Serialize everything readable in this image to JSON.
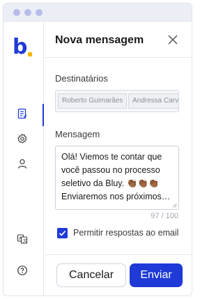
{
  "brand": {
    "logo_letter": "b",
    "accent": "#1f3ad6",
    "logo_dot_color": "#f4b400"
  },
  "window_controls": [
    "dot",
    "dot",
    "dot"
  ],
  "sidebar": {
    "items": [
      {
        "icon": "document-list-icon",
        "active": true
      },
      {
        "icon": "gear-icon",
        "active": false
      },
      {
        "icon": "user-icon",
        "active": false
      },
      {
        "icon": "translate-icon",
        "active": false
      },
      {
        "icon": "help-circle-icon",
        "active": false
      }
    ]
  },
  "header": {
    "title": "Nova mensagem",
    "close_icon": "close-icon"
  },
  "recipients": {
    "label": "Destinatários",
    "chips": [
      "Roberto Guimarães",
      "Andressa Carv"
    ]
  },
  "message": {
    "label": "Mensagem",
    "text": "Olá! Viemos te contar que\nvocê passou no processo\nseletivo da Bluy. 👏🏾👏🏾👏🏾\nEnviaremos nos próximos…",
    "counter": "97 / 100"
  },
  "allow_replies": {
    "label": "Permitir respostas ao email",
    "checked": true
  },
  "footer": {
    "cancel_label": "Cancelar",
    "send_label": "Enviar"
  }
}
